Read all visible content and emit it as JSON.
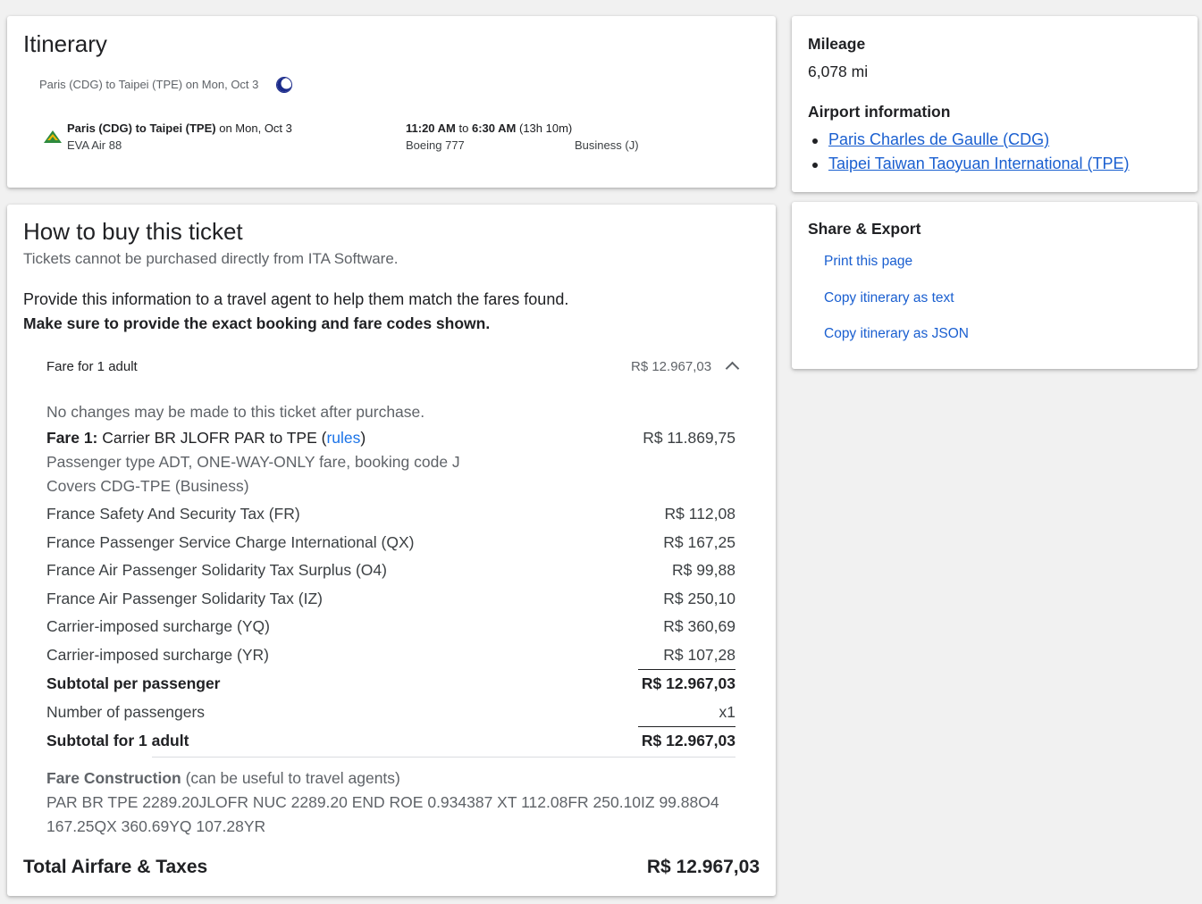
{
  "itinerary": {
    "title": "Itinerary",
    "summary": "Paris (CDG) to Taipei (TPE) on Mon, Oct 3",
    "summary_icon": "moon-icon",
    "segment": {
      "route": "Paris (CDG) to Taipei (TPE)",
      "date": "on Mon, Oct 3",
      "flight": "EVA Air 88",
      "depart": "11:20 AM",
      "to_word": "to",
      "arrive": "6:30 AM",
      "duration": "(13h 10m)",
      "aircraft": "Boeing 777",
      "cabin": "Business (J)",
      "airline_icon": "eva-air-logo-icon"
    }
  },
  "buy": {
    "title": "How to buy this ticket",
    "subtitle": "Tickets cannot be purchased directly from ITA Software.",
    "instruction": "Provide this information to a travel agent to help them match the fares found.",
    "instruction_bold": "Make sure to provide the exact booking and fare codes shown.",
    "fare_header": {
      "label": "Fare for 1 adult",
      "price": "R$ 12.967,03",
      "toggle_icon": "chevron-up-icon"
    },
    "no_changes": "No changes may be made to this ticket after purchase.",
    "fare1": {
      "label_bold": "Fare 1:",
      "label": "Carrier BR JLOFR PAR to TPE (",
      "rules_link": "rules",
      "label_end": ")",
      "price": "R$ 11.869,75",
      "detail1": "Passenger type ADT, ONE-WAY-ONLY fare, booking code J",
      "detail2": "Covers CDG-TPE (Business)"
    },
    "taxes": [
      {
        "label": "France Safety And Security Tax (FR)",
        "price": "R$ 112,08"
      },
      {
        "label": "France Passenger Service Charge International (QX)",
        "price": "R$ 167,25"
      },
      {
        "label": "France Air Passenger Solidarity Tax Surplus (O4)",
        "price": "R$ 99,88"
      },
      {
        "label": "France Air Passenger Solidarity Tax (IZ)",
        "price": "R$ 250,10"
      },
      {
        "label": "Carrier-imposed surcharge (YQ)",
        "price": "R$ 360,69"
      },
      {
        "label": "Carrier-imposed surcharge (YR)",
        "price": "R$ 107,28"
      }
    ],
    "subtotal_pp": {
      "label": "Subtotal per passenger",
      "price": "R$ 12.967,03"
    },
    "num_pax": {
      "label": "Number of passengers",
      "value": "x1"
    },
    "subtotal_adult": {
      "label": "Subtotal for 1 adult",
      "price": "R$ 12.967,03"
    },
    "fare_construction": {
      "label_bold": "Fare Construction",
      "label": "(can be useful to travel agents)",
      "line1": "PAR BR TPE 2289.20JLOFR NUC 2289.20 END ROE 0.934387 XT 112.08FR 250.10IZ 99.88O4",
      "line2": "167.25QX 360.69YQ 107.28YR"
    },
    "total": {
      "label": "Total Airfare & Taxes",
      "price": "R$ 12.967,03"
    }
  },
  "sidebar": {
    "mileage_title": "Mileage",
    "mileage_value": "6,078 mi",
    "airport_title": "Airport information",
    "airports": [
      "Paris Charles de Gaulle (CDG)",
      "Taipei Taiwan Taoyuan International (TPE)"
    ],
    "share_title": "Share & Export",
    "share_links": [
      "Print this page",
      "Copy itinerary as text",
      "Copy itinerary as JSON"
    ]
  }
}
